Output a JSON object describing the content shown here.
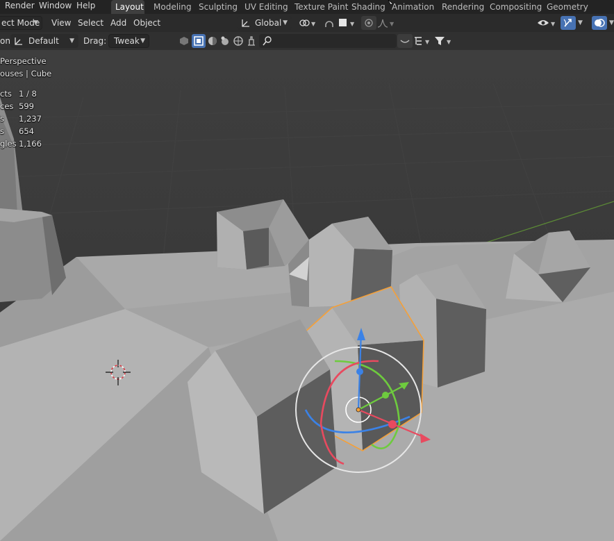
{
  "topbar": {
    "menus": [
      "Render",
      "Window",
      "Help"
    ],
    "workspaces": [
      "Layout",
      "Modeling",
      "Sculpting",
      "UV Editing",
      "Texture Paint",
      "Shading",
      "Animation",
      "Rendering",
      "Compositing",
      "Geometry Nodes"
    ],
    "active_workspace": "Layout"
  },
  "header": {
    "mode": "ect Mode",
    "view": "View",
    "select": "Select",
    "add": "Add",
    "object": "Object",
    "orientation": "Global"
  },
  "toolheader": {
    "orientation_label": "on:",
    "orientation_value": "Default",
    "drag_label": "Drag:",
    "drag_value": "Tweak",
    "search_placeholder": ""
  },
  "overlay": {
    "view_name": "Perspective",
    "collection": "ouses | Cube",
    "stats": [
      {
        "label": "cts",
        "value": "1 / 8"
      },
      {
        "label": "ces",
        "value": "599"
      },
      {
        "label": "s",
        "value": "1,237"
      },
      {
        "label": "s",
        "value": "654"
      },
      {
        "label": "gles",
        "value": "1,166"
      }
    ]
  },
  "colors": {
    "selection_outline": "#f5a038",
    "gizmo_x": "#e84a5f",
    "gizmo_y": "#6ecb3e",
    "gizmo_z": "#3b82e6",
    "active_button": "#4772b3"
  },
  "icons": [
    "eye-icon",
    "gizmo-icon",
    "overlay-icon",
    "snap-icon",
    "proportional-icon",
    "filter-icon",
    "search-icon",
    "cursor-icon"
  ]
}
